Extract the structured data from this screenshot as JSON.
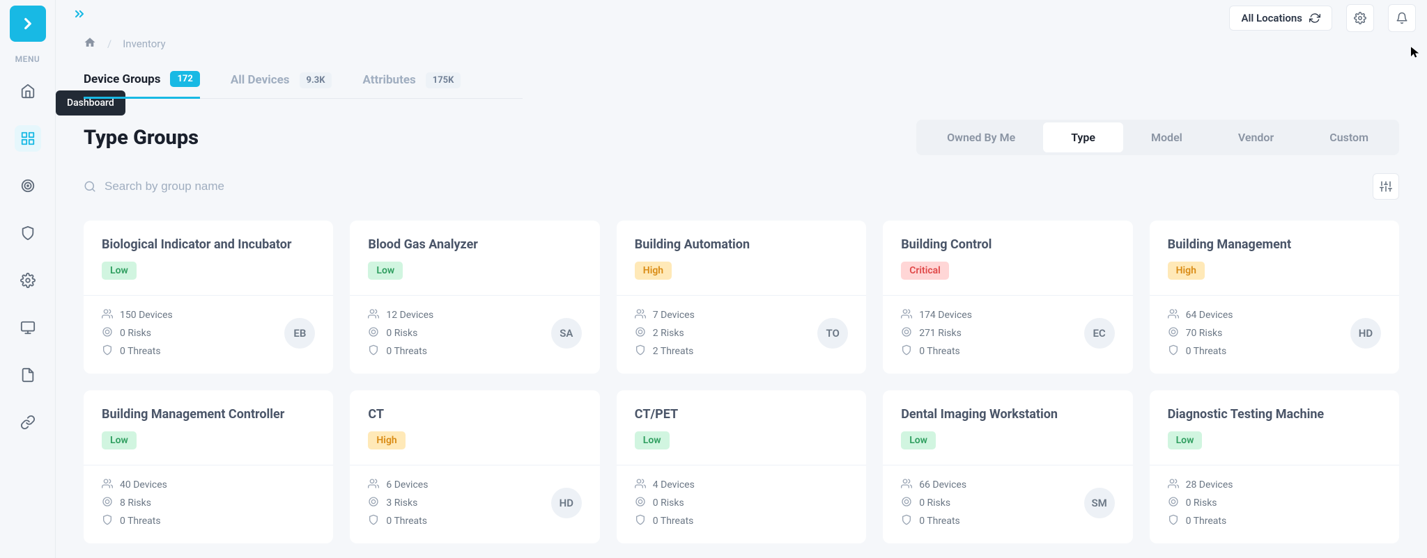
{
  "sidebar": {
    "menu_label": "MENU",
    "tooltip": "Dashboard"
  },
  "topbar": {
    "location_label": "All Locations"
  },
  "breadcrumb": {
    "current": "Inventory"
  },
  "tabs": [
    {
      "label": "Device Groups",
      "count": "172",
      "active": true
    },
    {
      "label": "All Devices",
      "count": "9.3K",
      "active": false
    },
    {
      "label": "Attributes",
      "count": "175K",
      "active": false
    }
  ],
  "page_title": "Type Groups",
  "filter_tabs": [
    {
      "label": "Owned By Me",
      "active": false
    },
    {
      "label": "Type",
      "active": true
    },
    {
      "label": "Model",
      "active": false
    },
    {
      "label": "Vendor",
      "active": false
    },
    {
      "label": "Custom",
      "active": false
    }
  ],
  "search": {
    "placeholder": "Search by group name"
  },
  "cards": [
    {
      "title": "Biological Indicator and Incubator",
      "risk": "Low",
      "devices": "150 Devices",
      "risks": "0 Risks",
      "threats": "0 Threats",
      "avatar": "EB"
    },
    {
      "title": "Blood Gas Analyzer",
      "risk": "Low",
      "devices": "12 Devices",
      "risks": "0 Risks",
      "threats": "0 Threats",
      "avatar": "SA"
    },
    {
      "title": "Building Automation",
      "risk": "High",
      "devices": "7 Devices",
      "risks": "2 Risks",
      "threats": "2 Threats",
      "avatar": "TO"
    },
    {
      "title": "Building Control",
      "risk": "Critical",
      "devices": "174 Devices",
      "risks": "271 Risks",
      "threats": "0 Threats",
      "avatar": "EC"
    },
    {
      "title": "Building Management",
      "risk": "High",
      "devices": "64 Devices",
      "risks": "70 Risks",
      "threats": "0 Threats",
      "avatar": "HD"
    },
    {
      "title": "Building Management Controller",
      "risk": "Low",
      "devices": "40 Devices",
      "risks": "8 Risks",
      "threats": "0 Threats",
      "avatar": ""
    },
    {
      "title": "CT",
      "risk": "High",
      "devices": "6 Devices",
      "risks": "3 Risks",
      "threats": "0 Threats",
      "avatar": "HD"
    },
    {
      "title": "CT/PET",
      "risk": "Low",
      "devices": "4 Devices",
      "risks": "0 Risks",
      "threats": "0 Threats",
      "avatar": ""
    },
    {
      "title": "Dental Imaging Workstation",
      "risk": "Low",
      "devices": "66 Devices",
      "risks": "0 Risks",
      "threats": "0 Threats",
      "avatar": "SM"
    },
    {
      "title": "Diagnostic Testing Machine",
      "risk": "Low",
      "devices": "28 Devices",
      "risks": "0 Risks",
      "threats": "0 Threats",
      "avatar": ""
    }
  ]
}
